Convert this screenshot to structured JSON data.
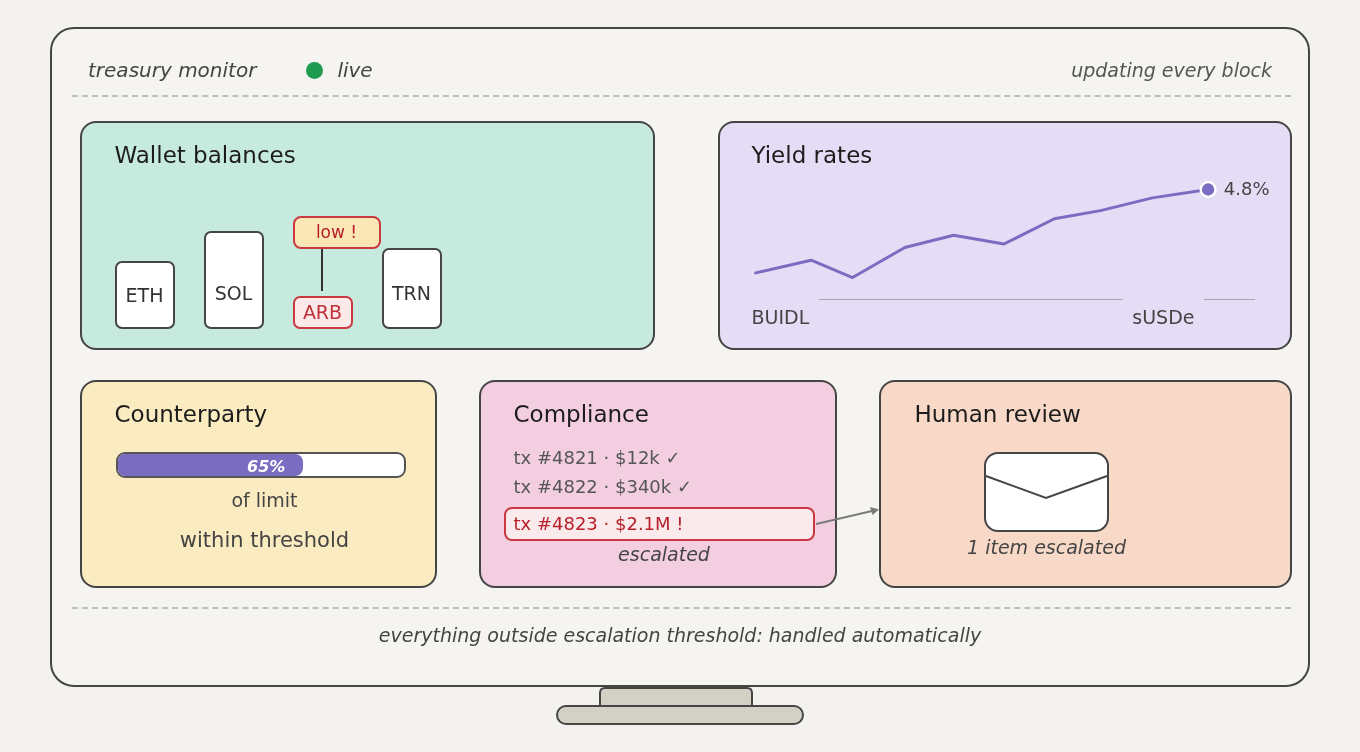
{
  "header": {
    "title": "treasury monitor",
    "status": {
      "label": "live",
      "on": true
    },
    "note": "updating every block"
  },
  "wallet_balances": {
    "title": "Wallet balances",
    "wallets": [
      {
        "label": "ETH",
        "low": false
      },
      {
        "label": "SOL",
        "low": false
      },
      {
        "label": "ARB",
        "low": true,
        "alert": "low !"
      },
      {
        "label": "TRN",
        "low": false
      }
    ]
  },
  "yield_rates": {
    "title": "Yield rates",
    "latest": "4.8%",
    "labels": [
      "BUIDL",
      "sUSDe"
    ]
  },
  "counterparty": {
    "title": "Counterparty",
    "usage": {
      "level": 0.65,
      "reading": "65%"
    },
    "caption": "of limit",
    "status": "within threshold"
  },
  "compliance": {
    "title": "Compliance",
    "transactions": [
      {
        "text": "tx #4821 · $12k ✓",
        "escalated": false
      },
      {
        "text": "tx #4822 · $340k ✓",
        "escalated": false
      },
      {
        "text": "tx #4823 · $2.1M !",
        "escalated": true
      }
    ],
    "note": "escalated"
  },
  "human_review": {
    "title": "Human review",
    "summary": "1 item escalated"
  },
  "footer": "everything outside escalation threshold: handled automatically"
}
